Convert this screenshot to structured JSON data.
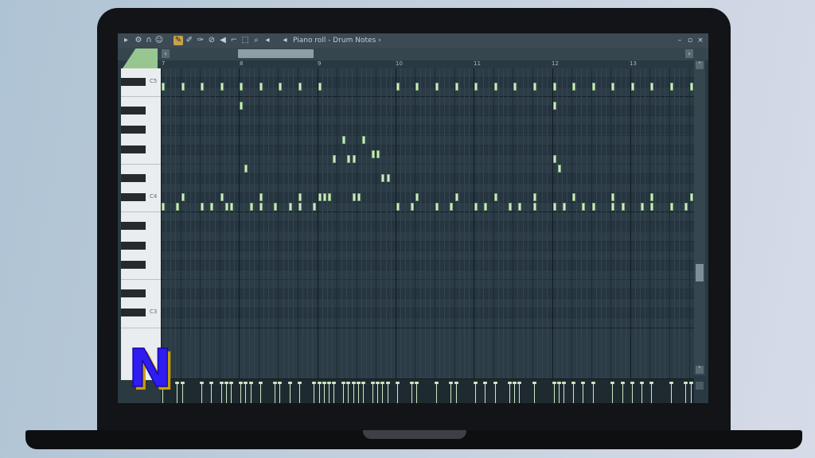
{
  "window": {
    "title": "Piano roll - Drum Notes",
    "title_arrow": "›",
    "menu_arrow": "▸",
    "minimize": "–",
    "maximize": "▫",
    "close": "×"
  },
  "toolbar": {
    "icons": [
      "wrench-icon",
      "magnet-icon",
      "smiley-icon",
      "pencil-icon",
      "paint-icon",
      "delete-icon",
      "mute-icon",
      "slice-icon",
      "select-icon",
      "zoom-icon",
      "speaker-icon"
    ],
    "active_icon": "pencil-icon"
  },
  "ruler": {
    "labels": [
      "7",
      "8",
      "9",
      "10",
      "11",
      "12",
      "13"
    ]
  },
  "keyboard": {
    "octave_labels": [
      "C5",
      "C4",
      "C3"
    ]
  },
  "scroll": {
    "left_arrow": "‹",
    "right_arrow": "›",
    "up_arrow": "˄",
    "down_arrow": "˅"
  },
  "logo": {
    "letter": "N",
    "fill": "#2f1cf0",
    "shadow": "#c9a000"
  },
  "colors": {
    "note": "#cde8c4",
    "grid": "#2c3c46",
    "accent": "#97c690"
  }
}
